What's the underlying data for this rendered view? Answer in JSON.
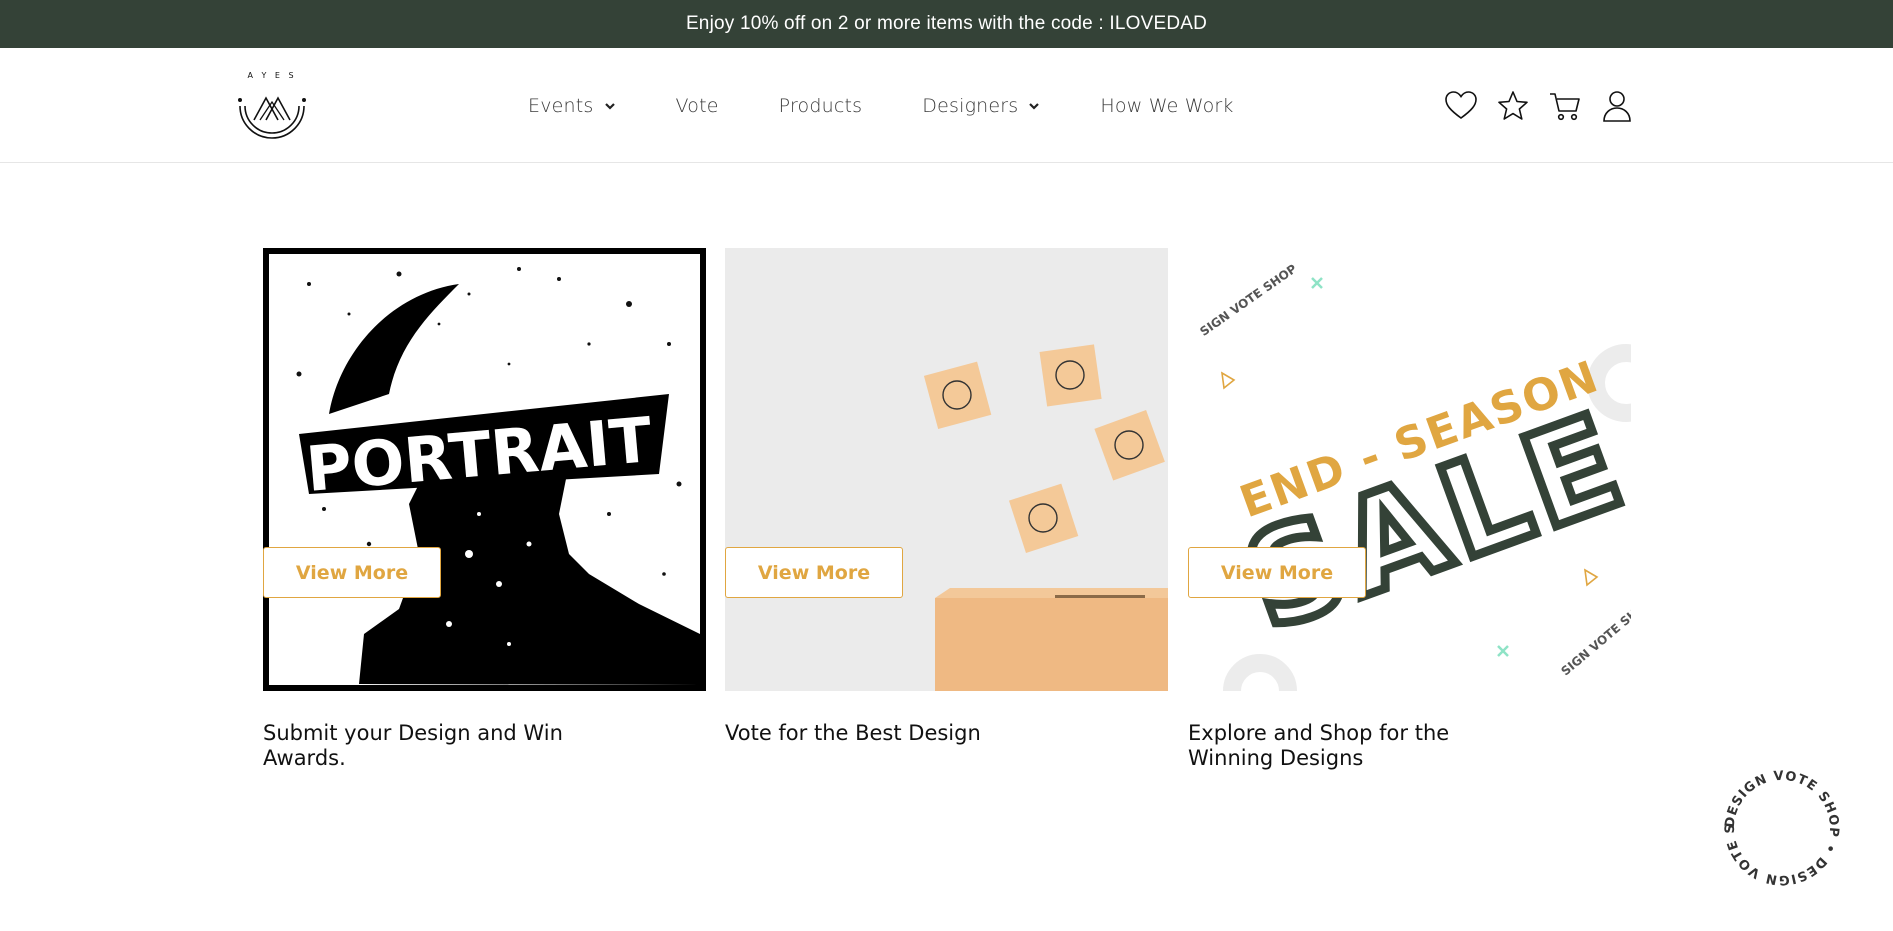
{
  "promo": {
    "text": "Enjoy 10% off on 2 or more items with the code : ILOVEDAD"
  },
  "logo": {
    "letters": "A Y E S",
    "icon": "ayes-logo-icon"
  },
  "nav": {
    "items": [
      {
        "label": "Events",
        "dropdown": true
      },
      {
        "label": "Vote",
        "dropdown": false
      },
      {
        "label": "Products",
        "dropdown": false
      },
      {
        "label": "Designers",
        "dropdown": true
      },
      {
        "label": "How We Work",
        "dropdown": false
      }
    ]
  },
  "header_icons": [
    "heart-icon",
    "star-icon",
    "cart-icon",
    "user-icon"
  ],
  "cards": [
    {
      "image_text": "PORTRAIT",
      "title": "Submit your Design and Win Awards.",
      "button": "View More"
    },
    {
      "image_text": "",
      "title": "Vote for the Best Design",
      "button": "View More"
    },
    {
      "image_text_top": "END - SEASON",
      "image_text_main": "SALE",
      "title": "Explore and Shop for the Winning Designs",
      "button": "View More"
    }
  ],
  "sale_ring_text": {
    "top": "SIGN VOTE SHOP",
    "bottom": "SIGN VOTE SHO"
  },
  "badge": {
    "text": "DESIGN VOTE SHOP • DESIGN VOTE SHOP •"
  },
  "colors": {
    "promo_bg": "#344237",
    "accent": "#e0a641",
    "dark_green": "#344237",
    "mint": "#8fe3c6"
  }
}
